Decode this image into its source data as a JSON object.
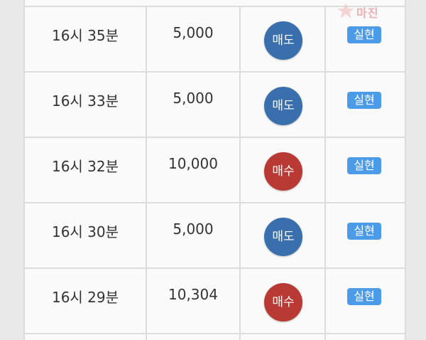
{
  "rows": [
    {
      "time": "16시 35분",
      "qty": "5,000",
      "type": "매도",
      "status": "실현"
    },
    {
      "time": "16시 33분",
      "qty": "5,000",
      "type": "매도",
      "status": "실현"
    },
    {
      "time": "16시 32분",
      "qty": "10,000",
      "type": "매수",
      "status": "실현"
    },
    {
      "time": "16시 30분",
      "qty": "5,000",
      "type": "매도",
      "status": "실현"
    },
    {
      "time": "16시 29분",
      "qty": "10,304",
      "type": "매수",
      "status": "실현"
    }
  ],
  "watermark": {
    "brand": "마진",
    "sub": ""
  },
  "colors": {
    "sell": "#3a6fae",
    "buy": "#b93a35",
    "status_badge": "#4c9be8"
  }
}
